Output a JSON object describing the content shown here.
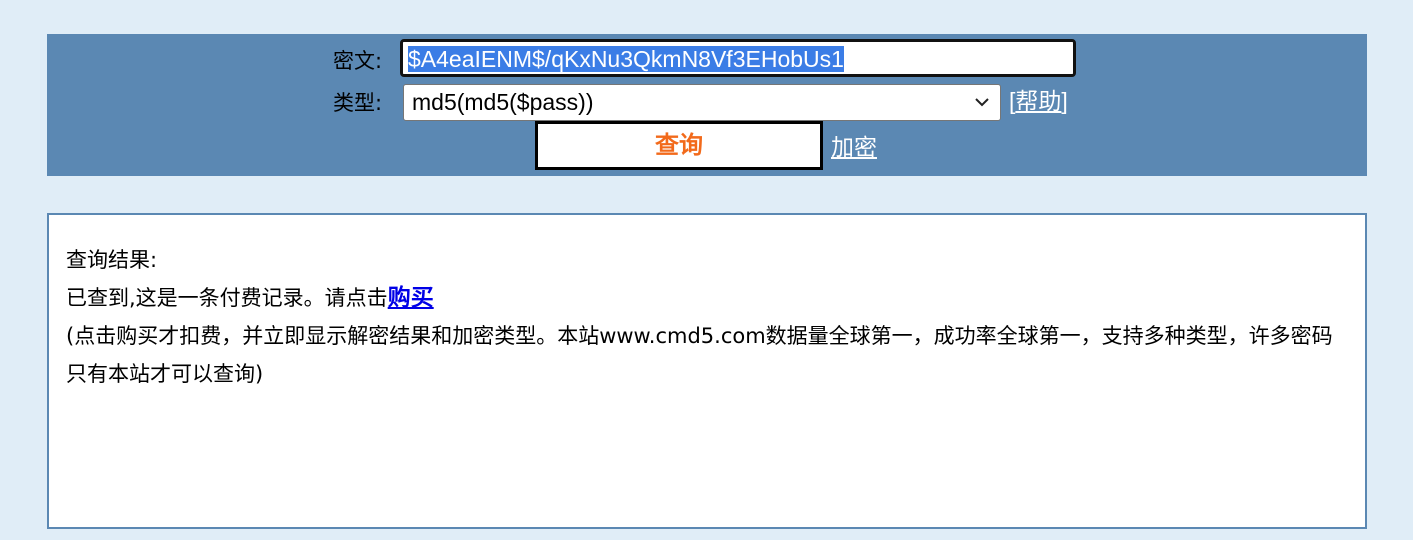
{
  "form": {
    "cipher_label": "密文:",
    "cipher_value": "$A4eaIENM$/qKxNu3QkmN8Vf3EHobUs1",
    "type_label": "类型:",
    "type_selected": "md5(md5($pass))",
    "help_open": "[",
    "help_text": "帮助",
    "help_close": "]",
    "query_button": "查询",
    "encrypt_link": "加密"
  },
  "result": {
    "title": "查询结果:",
    "message": "已查到,这是一条付费记录。请点击",
    "buy_link": "购买",
    "description": "(点击购买才扣费，并立即显示解密结果和加密类型。本站www.cmd5.com数据量全球第一，成功率全球第一，支持多种类型，许多密码只有本站才可以查询)"
  },
  "colors": {
    "background": "#e0edf7",
    "panel": "#5b88b3",
    "query_text": "#f26a1b",
    "buy_link": "#0000e6",
    "selection": "#3b7de6"
  },
  "icons": {
    "select_arrow": "chevron-down-icon"
  }
}
